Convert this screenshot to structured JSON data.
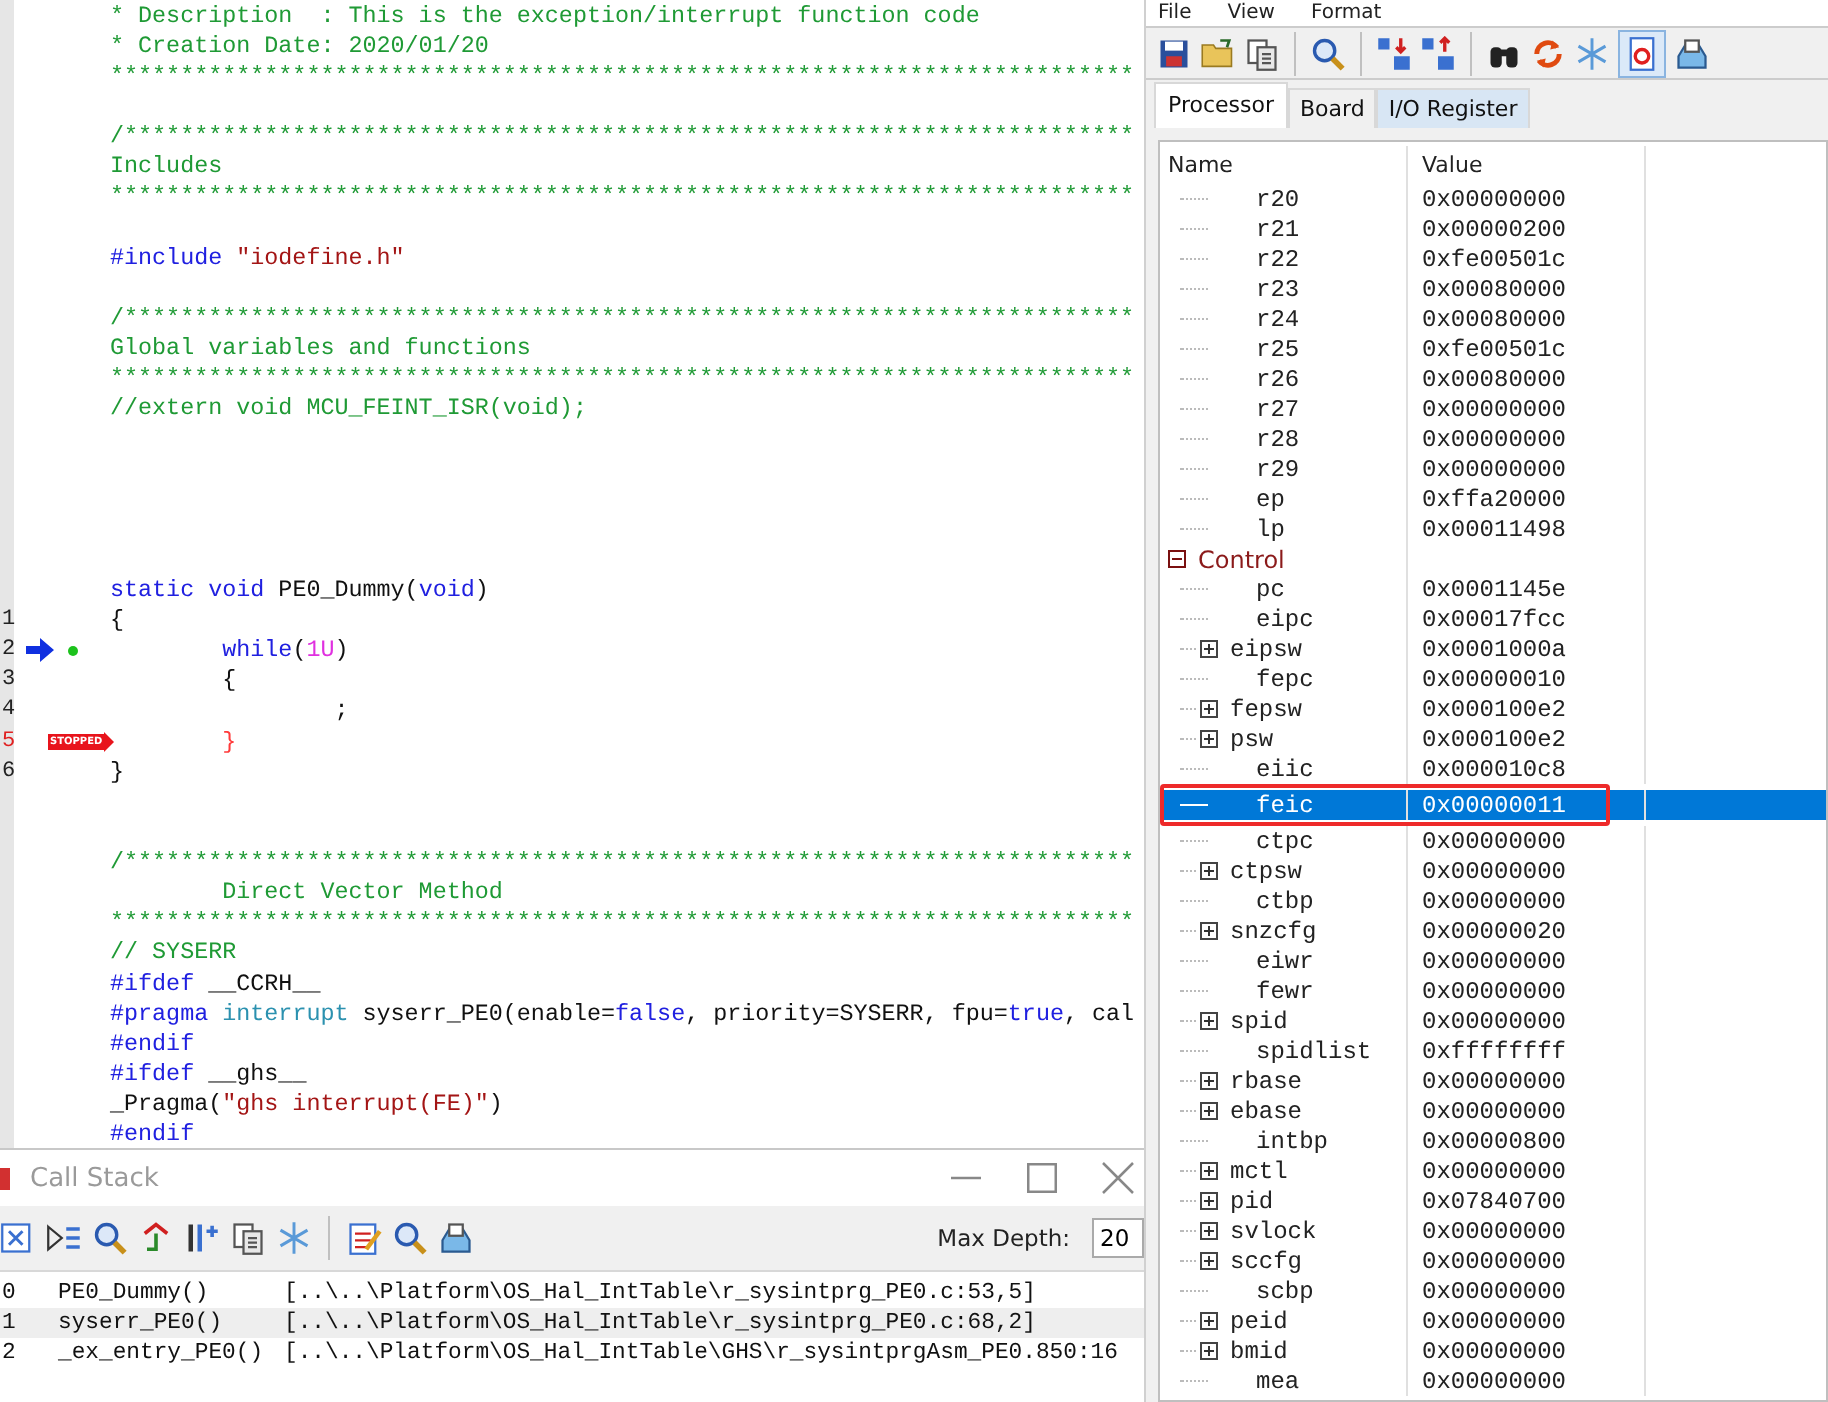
{
  "editor": {
    "lines": [
      {
        "kind": "code",
        "tokens": [
          {
            "text": "* Description  : This is the exception/interrupt function code",
            "kind": "comment"
          }
        ]
      },
      {
        "kind": "code",
        "tokens": [
          {
            "text": "* Creation Date: 2020/01/20",
            "kind": "comment"
          }
        ]
      },
      {
        "kind": "code",
        "tokens": [
          {
            "text": "*************************************************************************",
            "kind": "comment"
          }
        ]
      },
      {
        "kind": "blank"
      },
      {
        "kind": "code",
        "tokens": [
          {
            "text": "/************************************************************************",
            "kind": "comment"
          }
        ]
      },
      {
        "kind": "code",
        "tokens": [
          {
            "text": "Includes",
            "kind": "comment"
          }
        ]
      },
      {
        "kind": "code",
        "tokens": [
          {
            "text": "*************************************************************************",
            "kind": "comment"
          }
        ]
      },
      {
        "kind": "blank"
      },
      {
        "kind": "code",
        "tokens": [
          {
            "text": "#include",
            "kind": "preproc"
          },
          {
            "text": " \"iodefine.h\"",
            "kind": "string"
          }
        ]
      },
      {
        "kind": "blank"
      },
      {
        "kind": "code",
        "tokens": [
          {
            "text": "/************************************************************************",
            "kind": "comment"
          }
        ]
      },
      {
        "kind": "code",
        "tokens": [
          {
            "text": "Global variables and functions",
            "kind": "comment"
          }
        ]
      },
      {
        "kind": "code",
        "tokens": [
          {
            "text": "*************************************************************************",
            "kind": "comment"
          }
        ]
      },
      {
        "kind": "code",
        "tokens": [
          {
            "text": "//extern void MCU_FEINT_ISR(void);",
            "kind": "comment"
          }
        ]
      },
      {
        "kind": "blank"
      },
      {
        "kind": "blank"
      },
      {
        "kind": "blank"
      },
      {
        "kind": "blank"
      },
      {
        "kind": "blank"
      },
      {
        "kind": "code",
        "tokens": [
          {
            "text": "static",
            "kind": "keyword"
          },
          {
            "text": " void",
            "kind": "keyword"
          },
          {
            "text": " PE0_Dummy(",
            "kind": "plain"
          },
          {
            "text": "void",
            "kind": "keyword"
          },
          {
            "text": ")",
            "kind": "plain"
          }
        ]
      },
      {
        "kind": "code",
        "number": "1",
        "tokens": [
          {
            "text": "{",
            "kind": "plain"
          }
        ]
      },
      {
        "kind": "code",
        "number": "2",
        "current": true,
        "breakpoint": true,
        "tokens": [
          {
            "text": "\twhile",
            "kind": "keyword"
          },
          {
            "text": "(",
            "kind": "plain"
          },
          {
            "text": "1U",
            "kind": "number"
          },
          {
            "text": ")",
            "kind": "plain"
          }
        ]
      },
      {
        "kind": "code",
        "number": "3",
        "tokens": [
          {
            "text": "\t{",
            "kind": "plain"
          }
        ]
      },
      {
        "kind": "code",
        "number": "4",
        "tokens": [
          {
            "text": "\t\t;",
            "kind": "plain"
          }
        ]
      },
      {
        "kind": "code",
        "number": "5",
        "stopped": true,
        "marker_label": "STOPPED",
        "tokens": [
          {
            "text": "\t}",
            "kind": "stopped"
          }
        ]
      },
      {
        "kind": "code",
        "number": "6",
        "tokens": [
          {
            "text": "}",
            "kind": "plain"
          }
        ]
      },
      {
        "kind": "blank"
      },
      {
        "kind": "blank"
      },
      {
        "kind": "code",
        "tokens": [
          {
            "text": "/************************************************************************",
            "kind": "comment"
          }
        ]
      },
      {
        "kind": "code",
        "tokens": [
          {
            "text": "\tDirect Vector Method",
            "kind": "comment"
          }
        ]
      },
      {
        "kind": "code",
        "tokens": [
          {
            "text": "*************************************************************************",
            "kind": "comment"
          }
        ]
      },
      {
        "kind": "code",
        "tokens": [
          {
            "text": "// SYSERR",
            "kind": "comment"
          }
        ]
      },
      {
        "kind": "code",
        "tokens": [
          {
            "text": "#ifdef",
            "kind": "preproc"
          },
          {
            "text": " __CCRH__",
            "kind": "plain"
          }
        ]
      },
      {
        "kind": "code",
        "tokens": [
          {
            "text": "#pragma",
            "kind": "preproc"
          },
          {
            "text": " interrupt",
            "kind": "type"
          },
          {
            "text": " syserr_PE0(enable=",
            "kind": "plain"
          },
          {
            "text": "false",
            "kind": "keyword"
          },
          {
            "text": ", priority=SYSERR, fpu=",
            "kind": "plain"
          },
          {
            "text": "true",
            "kind": "keyword"
          },
          {
            "text": ", cal",
            "kind": "plain"
          }
        ]
      },
      {
        "kind": "code",
        "tokens": [
          {
            "text": "#endif",
            "kind": "preproc"
          }
        ]
      },
      {
        "kind": "code",
        "tokens": [
          {
            "text": "#ifdef",
            "kind": "preproc"
          },
          {
            "text": " __ghs__",
            "kind": "plain"
          }
        ]
      },
      {
        "kind": "code",
        "tokens": [
          {
            "text": "_Pragma(",
            "kind": "plain"
          },
          {
            "text": "\"ghs interrupt(FE)\"",
            "kind": "string"
          },
          {
            "text": ")",
            "kind": "plain"
          }
        ]
      },
      {
        "kind": "code",
        "tokens": [
          {
            "text": "#endif",
            "kind": "preproc"
          }
        ]
      }
    ]
  },
  "call_stack": {
    "title": "Call Stack",
    "toolbar": [
      {
        "kind": "cross"
      },
      {
        "kind": "step"
      },
      {
        "kind": "magnifier"
      },
      {
        "kind": "jump"
      },
      {
        "kind": "column"
      },
      {
        "kind": "copy"
      },
      {
        "kind": "snowflake"
      },
      {
        "kind": "separator"
      },
      {
        "kind": "notepad"
      },
      {
        "kind": "magnifier"
      },
      {
        "kind": "tray"
      }
    ],
    "max_depth_label": "Max Depth:",
    "max_depth": "20",
    "rows": [
      {
        "index": "0",
        "function": "PE0_Dummy()",
        "location": "[..\\..\\Platform\\OS_Hal_IntTable\\r_sysintprg_PE0.c:53,5]",
        "selected": false
      },
      {
        "index": "1",
        "function": "syserr_PE0()",
        "location": "[..\\..\\Platform\\OS_Hal_IntTable\\r_sysintprg_PE0.c:68,2]",
        "selected": true
      },
      {
        "index": "2",
        "function": "_ex_entry_PE0()",
        "location": "[..\\..\\Platform\\OS_Hal_IntTable\\GHS\\r_sysintprgAsm_PE0.850:16",
        "selected": false
      }
    ]
  },
  "register_window": {
    "menu": [
      "File",
      "View",
      "Format"
    ],
    "toolbar": [
      {
        "kind": "save"
      },
      {
        "kind": "open"
      },
      {
        "kind": "copy"
      },
      {
        "kind": "separator"
      },
      {
        "kind": "magnifier"
      },
      {
        "kind": "separator"
      },
      {
        "kind": "split-down"
      },
      {
        "kind": "split-up"
      },
      {
        "kind": "separator"
      },
      {
        "kind": "binoculars"
      },
      {
        "kind": "refresh"
      },
      {
        "kind": "snowflake"
      },
      {
        "kind": "auto-refresh",
        "pressed": true
      },
      {
        "kind": "tray"
      }
    ],
    "tabs": [
      {
        "label": "Processor",
        "selected": true,
        "hovered": false
      },
      {
        "label": "Board",
        "selected": false,
        "hovered": false
      },
      {
        "label": "I/O Register",
        "selected": false,
        "hovered": true
      }
    ],
    "columns": [
      "Name",
      "Value"
    ],
    "rows": [
      {
        "children": [
          {
            "name": "r20",
            "value": "0x00000000"
          },
          {
            "name": "r21",
            "value": "0x00000200"
          },
          {
            "name": "r22",
            "value": "0xfe00501c"
          },
          {
            "name": "r23",
            "value": "0x00080000"
          },
          {
            "name": "r24",
            "value": "0x00080000"
          },
          {
            "name": "r25",
            "value": "0xfe00501c"
          },
          {
            "name": "r26",
            "value": "0x00080000"
          },
          {
            "name": "r27",
            "value": "0x00000000"
          },
          {
            "name": "r28",
            "value": "0x00000000"
          },
          {
            "name": "r29",
            "value": "0x00000000"
          },
          {
            "name": "ep",
            "value": "0xffa20000"
          },
          {
            "name": "lp",
            "value": "0x00011498"
          }
        ]
      },
      {
        "name": "Control",
        "expanded": true,
        "children": [
          {
            "name": "pc",
            "value": "0x0001145e",
            "expandable": false,
            "selected": false
          },
          {
            "name": "eipc",
            "value": "0x00017fcc",
            "expandable": false,
            "selected": false
          },
          {
            "name": "eipsw",
            "value": "0x0001000a",
            "expandable": true,
            "selected": false
          },
          {
            "name": "fepc",
            "value": "0x00000010",
            "expandable": false,
            "selected": false
          },
          {
            "name": "fepsw",
            "value": "0x000100e2",
            "expandable": true,
            "selected": false
          },
          {
            "name": "psw",
            "value": "0x000100e2",
            "expandable": true,
            "selected": false
          },
          {
            "name": "eiic",
            "value": "0x000010c8",
            "expandable": false,
            "selected": false
          },
          {
            "name": "feic",
            "value": "0x00000011",
            "expandable": false,
            "selected": true,
            "annotated": true
          },
          {
            "name": "ctpc",
            "value": "0x00000000",
            "expandable": false,
            "selected": false
          },
          {
            "name": "ctpsw",
            "value": "0x00000000",
            "expandable": true,
            "selected": false
          },
          {
            "name": "ctbp",
            "value": "0x00000000",
            "expandable": false,
            "selected": false
          },
          {
            "name": "snzcfg",
            "value": "0x00000020",
            "expandable": true,
            "selected": false
          },
          {
            "name": "eiwr",
            "value": "0x00000000",
            "expandable": false,
            "selected": false
          },
          {
            "name": "fewr",
            "value": "0x00000000",
            "expandable": false,
            "selected": false
          },
          {
            "name": "spid",
            "value": "0x00000000",
            "expandable": true,
            "selected": false
          },
          {
            "name": "spidlist",
            "value": "0xffffffff",
            "expandable": false,
            "selected": false
          },
          {
            "name": "rbase",
            "value": "0x00000000",
            "expandable": true,
            "selected": false
          },
          {
            "name": "ebase",
            "value": "0x00000000",
            "expandable": true,
            "selected": false
          },
          {
            "name": "intbp",
            "value": "0x00000800",
            "expandable": false,
            "selected": false
          },
          {
            "name": "mctl",
            "value": "0x00000000",
            "expandable": true,
            "selected": false
          },
          {
            "name": "pid",
            "value": "0x07840700",
            "expandable": true,
            "selected": false
          },
          {
            "name": "svlock",
            "value": "0x00000000",
            "expandable": true,
            "selected": false
          },
          {
            "name": "sccfg",
            "value": "0x00000000",
            "expandable": true,
            "selected": false
          },
          {
            "name": "scbp",
            "value": "0x00000000",
            "expandable": false,
            "selected": false
          },
          {
            "name": "peid",
            "value": "0x00000000",
            "expandable": true,
            "selected": false
          },
          {
            "name": "bmid",
            "value": "0x00000000",
            "expandable": true,
            "selected": false
          },
          {
            "name": "mea",
            "value": "0x00000000",
            "expandable": false,
            "selected": false
          }
        ]
      }
    ]
  }
}
